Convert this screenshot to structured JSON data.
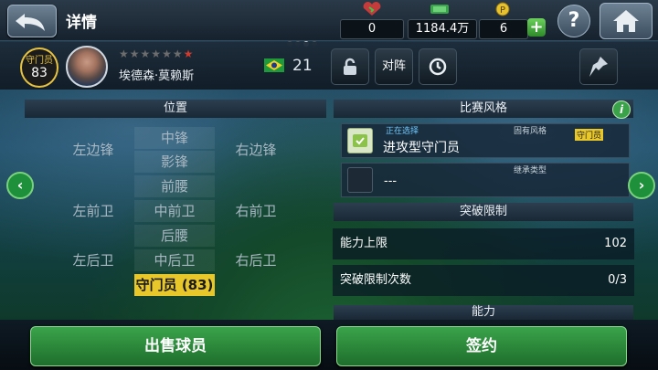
{
  "header": {
    "title": "详情",
    "resources": [
      {
        "icon": "stamina-icon",
        "value": "0"
      },
      {
        "icon": "cash-icon",
        "value": "1184.4万"
      },
      {
        "icon": "coin-icon",
        "value": "6"
      }
    ],
    "help_label": "?"
  },
  "player": {
    "position": "守门员",
    "overall": "83",
    "stars": "★★★★★★★",
    "name": "埃德森·莫赖斯",
    "rating": "21",
    "lineup_label": "对阵"
  },
  "positions_panel": {
    "title": "位置",
    "cells": {
      "lw": "左边锋",
      "st": "中锋",
      "rw": "右边锋",
      "ss": "影锋",
      "cam": "前腰",
      "lm": "左前卫",
      "cm": "中前卫",
      "rm": "右前卫",
      "cdm": "后腰",
      "lb": "左后卫",
      "cb": "中后卫",
      "rb": "右后卫",
      "gk": "守门员 (83)"
    }
  },
  "style_panel": {
    "title": "比赛风格",
    "selecting_label": "正在选择",
    "native_label": "固有风格",
    "native_badge": "守门员",
    "current_style": "进攻型守门员",
    "inherit_label": "继承类型",
    "inherit_value": "---"
  },
  "breakthrough": {
    "title": "突破限制",
    "rows": [
      {
        "label": "能力上限",
        "value": "102"
      },
      {
        "label": "突破限制次数",
        "value": "0/3"
      }
    ]
  },
  "ability_title": "能力",
  "actions": {
    "sell_label": "出售球员",
    "contract_label": "签约"
  }
}
